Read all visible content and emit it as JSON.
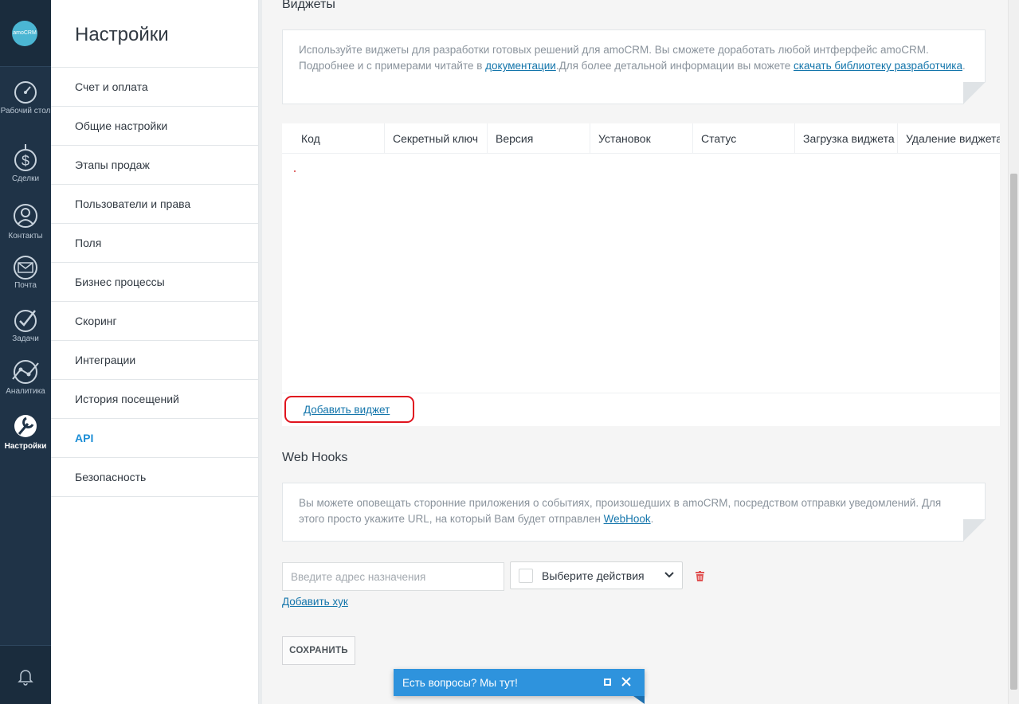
{
  "leftnav": {
    "logo_text": "amoCRM",
    "items": [
      {
        "label": "Рабочий стол",
        "icon": "dashboard-icon"
      },
      {
        "label": "Сделки",
        "icon": "deals-dollar-icon"
      },
      {
        "label": "Контакты",
        "icon": "contacts-icon"
      },
      {
        "label": "Почта",
        "icon": "mail-icon"
      },
      {
        "label": "Задачи",
        "icon": "tasks-check-icon"
      },
      {
        "label": "Аналитика",
        "icon": "analytics-icon"
      },
      {
        "label": "Настройки",
        "icon": "settings-wrench-icon",
        "active": true
      }
    ],
    "bottom_icon": "bell-icon"
  },
  "settings": {
    "title": "Настройки",
    "items": [
      "Счет и оплата",
      "Общие настройки",
      "Этапы продаж",
      "Пользователи и права",
      "Поля",
      "Бизнес процессы",
      "Скоринг",
      "Интеграции",
      "История посещений",
      "API",
      "Безопасность"
    ],
    "active_item": "API"
  },
  "widgets": {
    "title": "Виджеты",
    "note": {
      "text1": "Используйте виджеты для разработки готовых решений для amoCRM. Вы сможете доработать любой интферфейс amoCRM. Подробнее и с примерами читайте в ",
      "link1": "документации",
      "text2": ".Для более детальной информации вы можете ",
      "link2": "скачать библиотеку разработчика",
      "text3": "."
    },
    "columns": [
      "Код",
      "Секретный ключ",
      "Версия",
      "Установок",
      "Статус",
      "Загрузка виджета",
      "Удаление виджета"
    ],
    "add_widget_label": "Добавить виджет"
  },
  "webhooks": {
    "title": "Web Hooks",
    "note": {
      "text1": "Вы можете оповещать сторонние приложения о событиях, произошедших в amoCRM, посредством отправки уведомлений. Для этого просто укажите URL, на который Вам будет отправлен ",
      "link1": "WebHook",
      "text2": "."
    },
    "input_placeholder": "Введите адрес назначения",
    "select_label": "Выберите действия",
    "add_hook_label": "Добавить хук"
  },
  "save_label": "СОХРАНИТЬ",
  "chat": {
    "title": "Есть вопросы? Мы тут!"
  },
  "colors": {
    "nav_bg": "#1f3347",
    "accent": "#1c8ed6",
    "link": "#1375ab",
    "highlight": "#e0141e",
    "chat_bg": "#2e93dd"
  }
}
